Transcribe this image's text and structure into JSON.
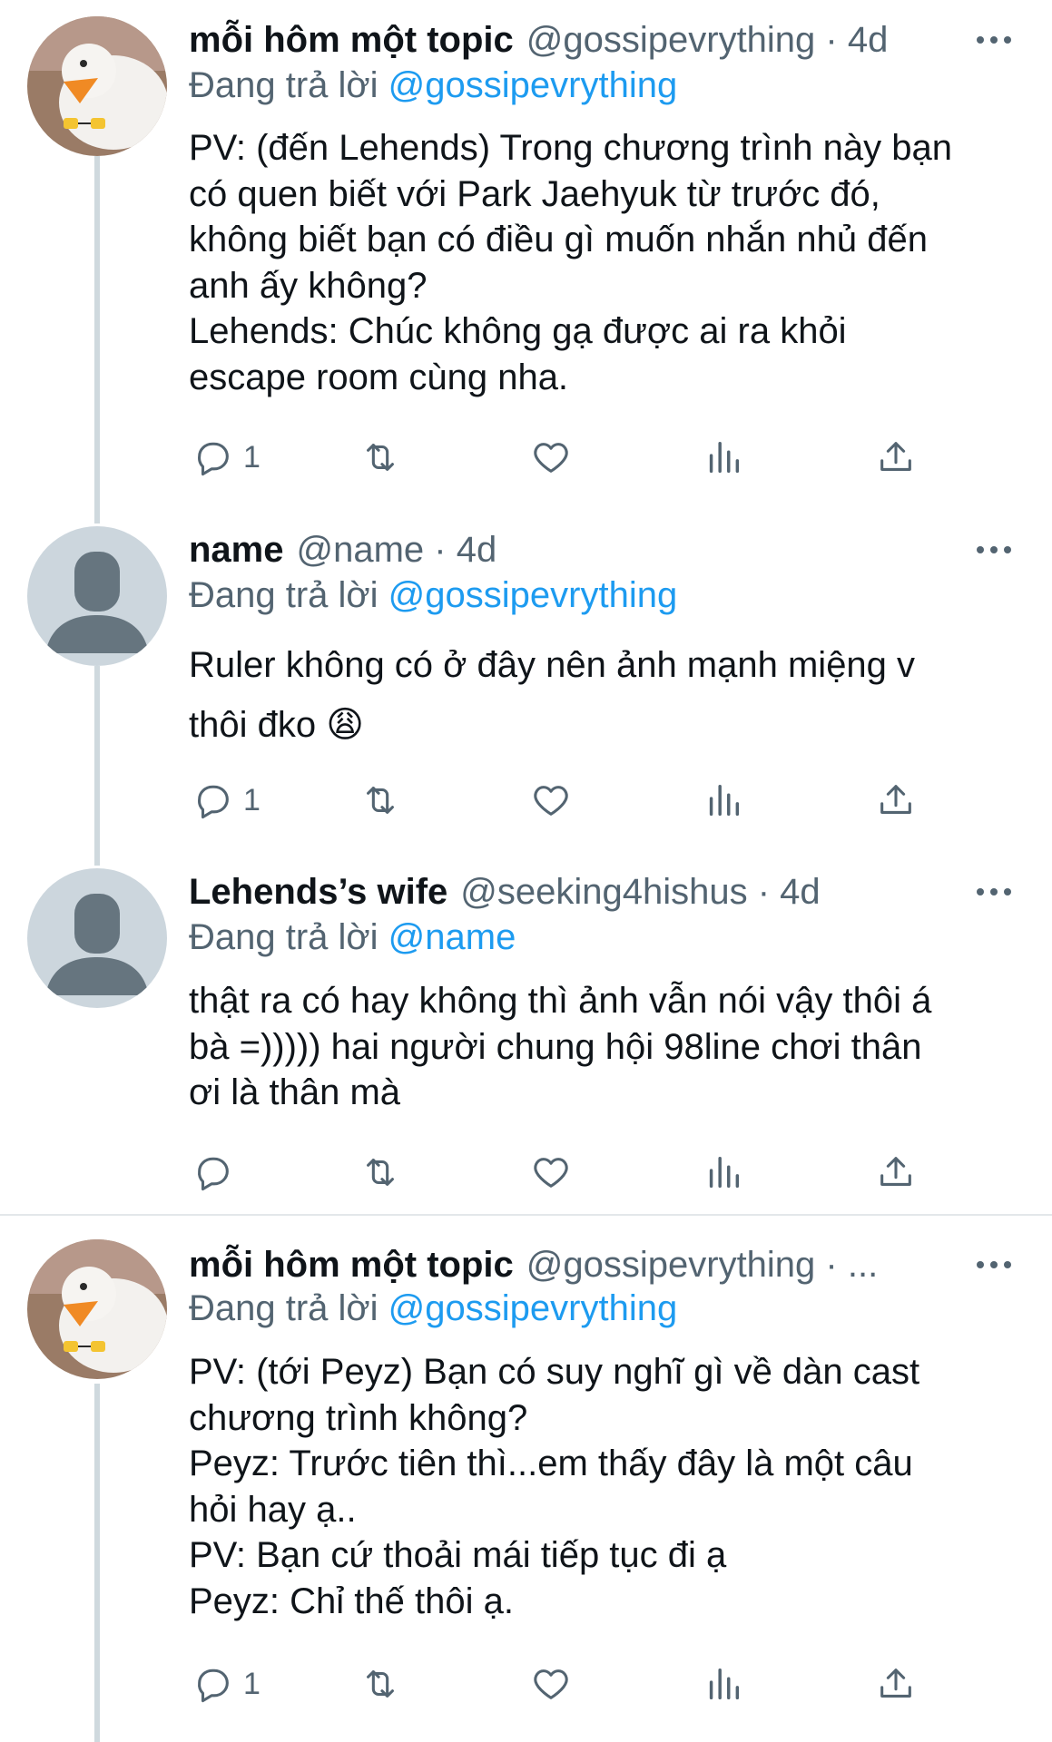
{
  "colors": {
    "link": "#1d9bf0",
    "muted": "#536471",
    "thread_line": "#cfd9de"
  },
  "icons": [
    "reply-icon",
    "retweet-icon",
    "like-icon",
    "analytics-icon",
    "share-icon",
    "more-icon"
  ],
  "tweets": [
    {
      "display_name": "mỗi hôm một topic",
      "meta": "@gossipevrything · 4d",
      "reply_prefix": "Đang trả lời",
      "reply_handle": "@gossipevrything",
      "text": "PV: (đến Lehends) Trong chương trình này bạn\ncó quen biết với Park Jaehyuk từ trước đó,\nkhông biết bạn có điều gì muốn nhắn nhủ đến\nanh ấy không?\nLehends: Chúc không gạ được ai ra khỏi\nescape room cùng nha.",
      "reply_count": "1"
    },
    {
      "display_name": "name",
      "meta": "@name · 4d",
      "reply_prefix": "Đang trả lời",
      "reply_handle": "@gossipevrything",
      "text": "Ruler không có ở đây nên ảnh mạnh miệng v\nthôi đko 😩",
      "reply_count": "1"
    },
    {
      "display_name": "Lehends’s wife",
      "meta": "@seeking4hishus · 4d",
      "reply_prefix": "Đang trả lời",
      "reply_handle": "@name",
      "text": "thật ra có hay không thì ảnh vẫn nói vậy thôi á\nbà =))))) hai người chung hội 98line chơi thân\nơi là thân mà",
      "reply_count": ""
    },
    {
      "display_name": "mỗi hôm một topic",
      "meta": "@gossipevrything · ...",
      "reply_prefix": "Đang trả lời",
      "reply_handle": "@gossipevrything",
      "text": "PV: (tới Peyz) Bạn có suy nghĩ gì về dàn cast\nchương trình không?\nPeyz: Trước tiên thì...em thấy đây là một câu\nhỏi hay ạ..\nPV: Bạn cứ thoải mái tiếp tục đi ạ\nPeyz: Chỉ thế thôi ạ.",
      "reply_count": "1"
    }
  ]
}
